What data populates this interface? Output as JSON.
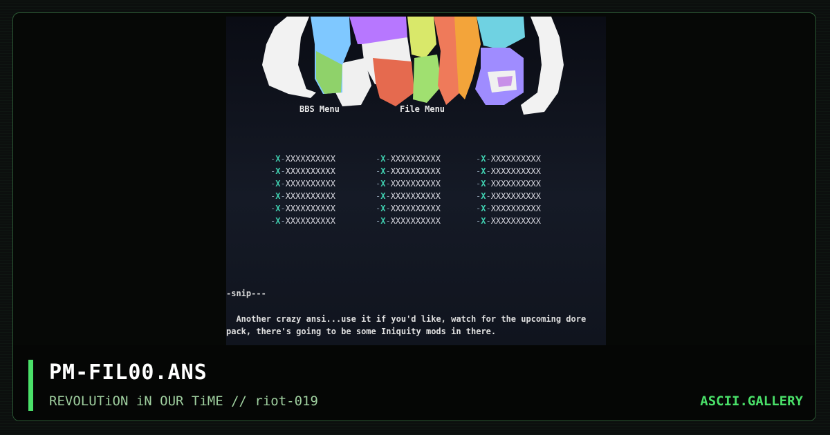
{
  "artwork": {
    "menu_labels": [
      "BBS Menu",
      "File Menu"
    ],
    "menu_columns": [
      [
        "XXXXXXXXXX",
        "XXXXXXXXXX",
        "XXXXXXXXXX",
        "XXXXXXXXXX",
        "XXXXXXXXXX",
        "XXXXXXXXXX"
      ],
      [
        "XXXXXXXXXX",
        "XXXXXXXXXX",
        "XXXXXXXXXX",
        "XXXXXXXXXX",
        "XXXXXXXXXX",
        "XXXXXXXXXX"
      ],
      [
        "XXXXXXXXXX",
        "XXXXXXXXXX",
        "XXXXXXXXXX",
        "XXXXXXXXXX",
        "XXXXXXXXXX",
        "XXXXXXXXXX"
      ]
    ],
    "menu_marker": "X",
    "snip": "-snip---",
    "description_line1": "  Another crazy ansi...use it if you'd like, watch for the upcoming dore",
    "description_line2": "pack, there's going to be some Iniquity mods in there."
  },
  "footer": {
    "title": "PM-FIL00.ANS",
    "subtitle": "REVOLUTiON iN OUR TiME // riot-019",
    "brand": "ASCII.GALLERY"
  },
  "colors": {
    "accent": "#4ae069",
    "frame_border": "#2c5a35",
    "background": "#0c0f0e"
  }
}
